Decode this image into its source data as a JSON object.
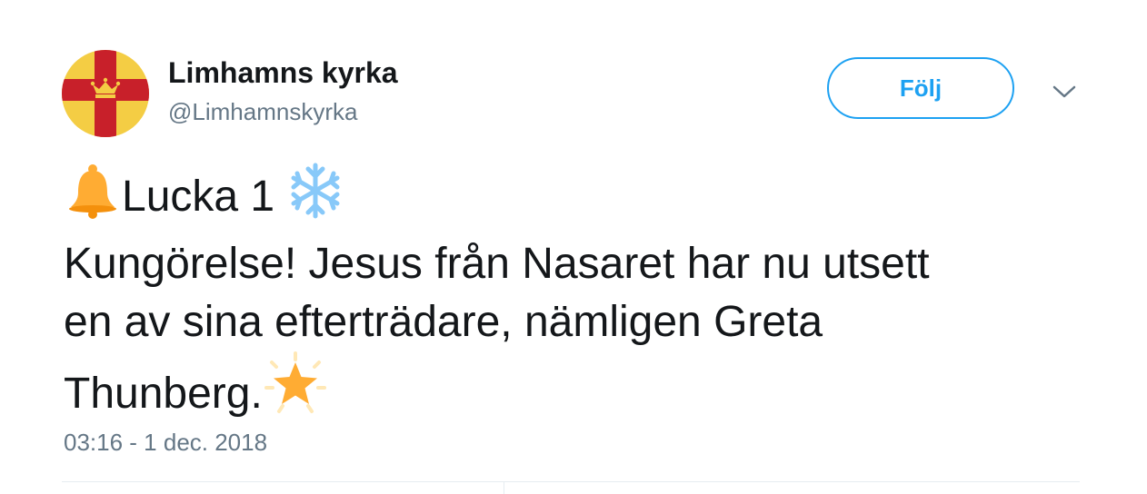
{
  "author": {
    "display_name": "Limhamns kyrka",
    "handle": "@Limhamnskyrka",
    "avatar_icon": "church-cross-crown-logo"
  },
  "follow_button": {
    "label": "Följ"
  },
  "menu": {
    "icon": "chevron-down-icon"
  },
  "tweet": {
    "line1_text": "Lucka 1",
    "line1_leading_emoji": "bell-emoji",
    "line1_trailing_emoji": "snowflake-emoji",
    "line2_text": "Kungörelse! Jesus från Nasaret har nu utsett",
    "line3_text": "en av sina efterträdare, nämligen Greta",
    "line4_text": "Thunberg.",
    "line4_trailing_emoji": "glowing-star-emoji"
  },
  "timestamp": "03:16 - 1 dec. 2018",
  "colors": {
    "accent": "#1da1f2",
    "text": "#14171a",
    "muted": "#657786",
    "logo_yellow": "#f4cd44",
    "logo_red": "#c8202a",
    "bell": "#ffac33",
    "snowflake": "#88c9f9",
    "star": "#ffac33"
  }
}
